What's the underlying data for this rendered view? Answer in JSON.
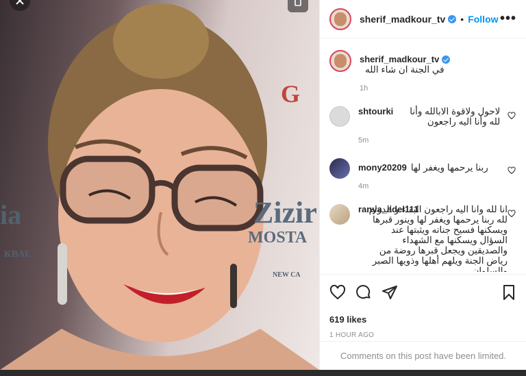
{
  "post": {
    "backdrop_texts": [
      "Zizir",
      "MOSTA",
      "ia",
      "KBAL",
      "NEW CA",
      "G"
    ]
  },
  "header": {
    "username": "sherif_madkour_tv",
    "dot": "•",
    "follow_label": "Follow",
    "more_label": "•••"
  },
  "caption": {
    "username": "sherif_madkour_tv",
    "text": "في الجنة ان شاء الله",
    "time": "1h"
  },
  "comments": [
    {
      "username": "shtourki",
      "text": "لاحول ولاقوة الابالله وأنا لله وأنا اليه راجعون",
      "time": "5m"
    },
    {
      "username": "mony20209",
      "text": "ربنا يرحمها ويغفر لها",
      "time": "4m"
    },
    {
      "username": "ranya_adel111",
      "text": "انا لله وانا اليه راجعون البقاء و الدوام لله ربنا يرحمها ويغفر لها وينور قبرها ويسكنها فسيح جناته ويثبتها عند السؤال ويسكنها مع الشهداء والصديقين ويجعل قبرها روضة من رياض الجنة ويلهم أهلها وذويها الصبر والسلوان",
      "time": ""
    }
  ],
  "likes": "619 likes",
  "time_ago": "1 HOUR AGO",
  "limited_notice": "Comments on this post have been limited.",
  "colors": {
    "follow": "#0095f6",
    "verified": "#3897f0",
    "muted": "#8e8e8e"
  }
}
